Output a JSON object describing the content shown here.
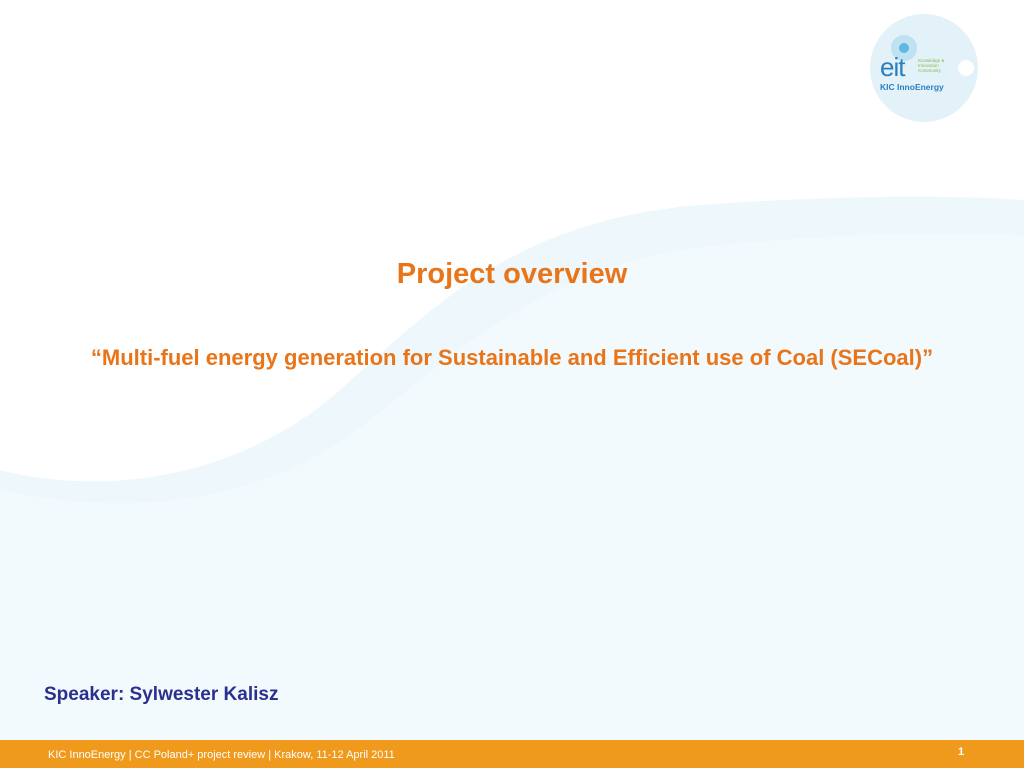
{
  "logo": {
    "mark": "eit",
    "tagline_lines": [
      "Knowledge &",
      "Innovation",
      "Community"
    ],
    "brand": "KIC InnoEnergy"
  },
  "title": "Project overview",
  "subtitle": "“Multi-fuel energy generation for Sustainable and Efficient use of Coal (SECoal)”",
  "speaker": "Speaker: Sylwester Kalisz",
  "footer": {
    "text": "KIC InnoEnergy | CC Poland+ project review | Krakow, 11-12 April 2011",
    "page_number": "1"
  },
  "colors": {
    "accent_orange": "#e8751a",
    "footer_bar": "#f09a1d",
    "speaker_navy": "#2b2f8e",
    "wave_blue": "#eef7fb",
    "logo_blue": "#2a7fbf"
  }
}
